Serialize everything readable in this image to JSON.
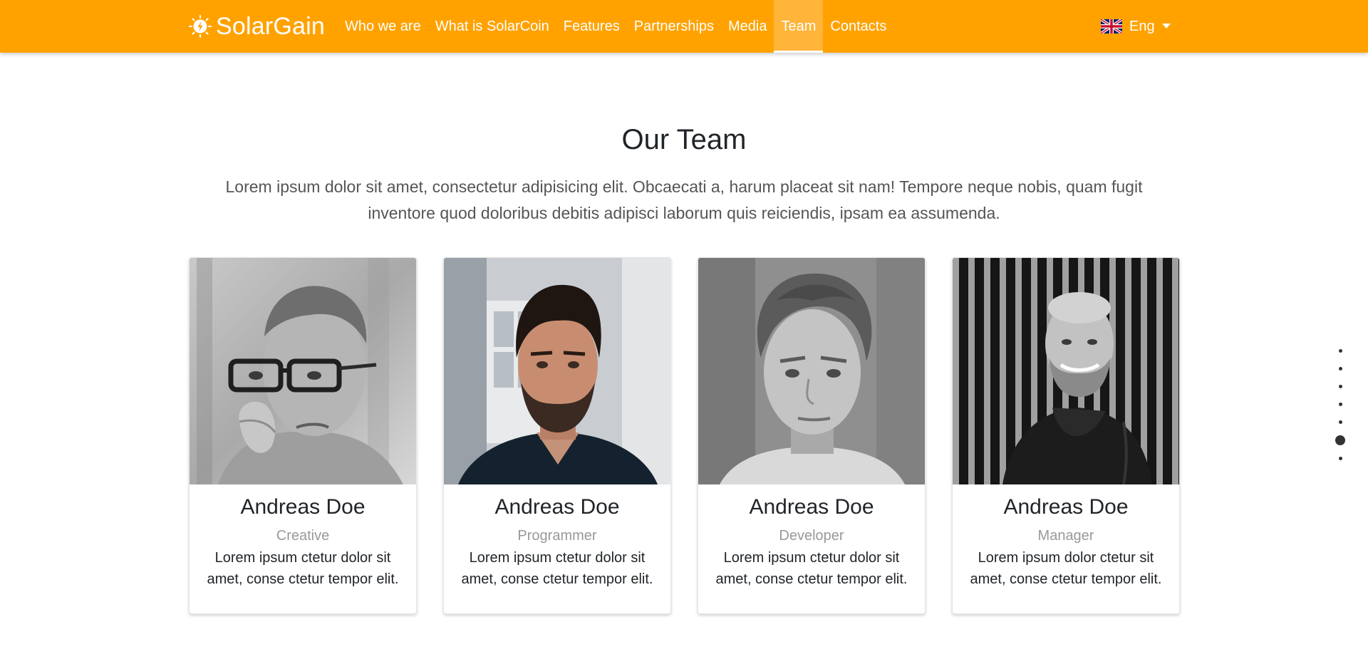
{
  "navbar": {
    "brand": "SolarGain",
    "links": [
      {
        "label": "Who we are",
        "active": false
      },
      {
        "label": "What is SolarCoin",
        "active": false
      },
      {
        "label": "Features",
        "active": false
      },
      {
        "label": "Partnerships",
        "active": false
      },
      {
        "label": "Media",
        "active": false
      },
      {
        "label": "Team",
        "active": true
      },
      {
        "label": "Contacts",
        "active": false
      }
    ],
    "language": {
      "label": "Eng",
      "icon": "uk-flag-icon"
    }
  },
  "team": {
    "title": "Our Team",
    "lead": "Lorem ipsum dolor sit amet, consectetur adipisicing elit. Obcaecati a, harum placeat sit nam! Tempore neque nobis, quam fugit inventore quod doloribus debitis adipisci laborum quis reiciendis, ipsam ea assumenda.",
    "members": [
      {
        "name": "Andreas Doe",
        "role": "Creative",
        "bio": "Lorem ipsum ctetur dolor sit amet, conse ctetur tempor elit."
      },
      {
        "name": "Andreas Doe",
        "role": "Programmer",
        "bio": "Lorem ipsum ctetur dolor sit amet, conse ctetur tempor elit."
      },
      {
        "name": "Andreas Doe",
        "role": "Developer",
        "bio": "Lorem ipsum ctetur dolor sit amet, conse ctetur tempor elit."
      },
      {
        "name": "Andreas Doe",
        "role": "Manager",
        "bio": "Lorem ipsum dolor ctetur sit amet, conse ctetur tempor elit."
      }
    ]
  },
  "section_nav": {
    "count": 7,
    "active_index": 5
  },
  "colors": {
    "navbar": "#ffa200",
    "active_link_bg": "#ffb43a",
    "text": "#212529",
    "muted": "#999999"
  }
}
